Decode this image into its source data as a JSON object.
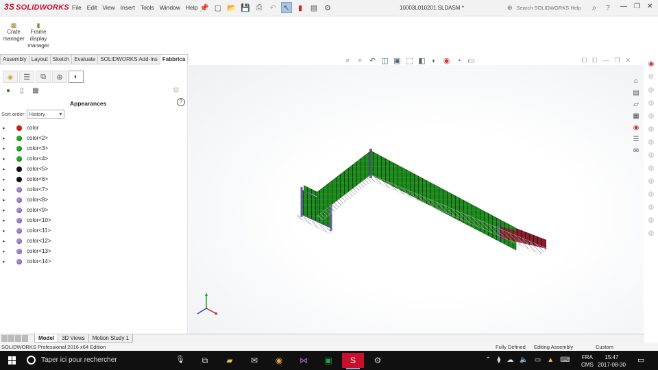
{
  "titlebar": {
    "logo_mark": "3S",
    "logo_text": "SOLIDWORKS",
    "menus": [
      "File",
      "Edit",
      "View",
      "Insert",
      "Tools",
      "Window",
      "Help"
    ],
    "document_title": "10003L010201.SLDASM *",
    "search_placeholder": "Search SOLIDWORKS Help",
    "help_label": "?"
  },
  "command_manager": {
    "buttons": [
      {
        "label": "Crate manager"
      },
      {
        "label": "Frame display manager"
      }
    ]
  },
  "ribbon_tabs": [
    "Assembly",
    "Layout",
    "Sketch",
    "Evaluate",
    "SOLIDWORKS Add-Ins",
    "Fabbrica"
  ],
  "active_ribbon_tab": "Fabbrica",
  "panel": {
    "title": "Appearances",
    "sort_label": "Sort order:",
    "sort_value": "History",
    "help_label": "?",
    "items": [
      {
        "label": "color",
        "color": "#d62020"
      },
      {
        "label": "color<2>",
        "color": "#22b022"
      },
      {
        "label": "color<3>",
        "color": "#22b022"
      },
      {
        "label": "color<4>",
        "color": "#22b022"
      },
      {
        "label": "color<5>",
        "color": "#111111"
      },
      {
        "label": "color<6>",
        "color": "#111111"
      },
      {
        "label": "color<7>",
        "color": "#a98ad6"
      },
      {
        "label": "color<8>",
        "color": "#a98ad6"
      },
      {
        "label": "color<9>",
        "color": "#a98ad6"
      },
      {
        "label": "color<10>",
        "color": "#a98ad6"
      },
      {
        "label": "color<11>",
        "color": "#a98ad6"
      },
      {
        "label": "color<12>",
        "color": "#a98ad6"
      },
      {
        "label": "color<13>",
        "color": "#a98ad6"
      },
      {
        "label": "color<14>",
        "color": "#a98ad6"
      }
    ]
  },
  "bottom_tabs": [
    "Model",
    "3D Views",
    "Motion Study 1"
  ],
  "active_bottom_tab": "Model",
  "status": {
    "product": "SOLIDWORKS Professional 2016 x64 Edition",
    "defined": "Fully Defined",
    "mode": "Editing Assembly",
    "units": "Custom"
  },
  "taskbar": {
    "search_placeholder": "Taper ici pour rechercher",
    "language": "FRA",
    "language_sub": "CMS",
    "time": "15:47",
    "date": "2017-08-30"
  },
  "colors": {
    "frame_green": "#1e8a1e",
    "frame_red": "#8a1e2e",
    "frame_purple": "#6a5aa0",
    "accent_red": "#c8102e"
  }
}
